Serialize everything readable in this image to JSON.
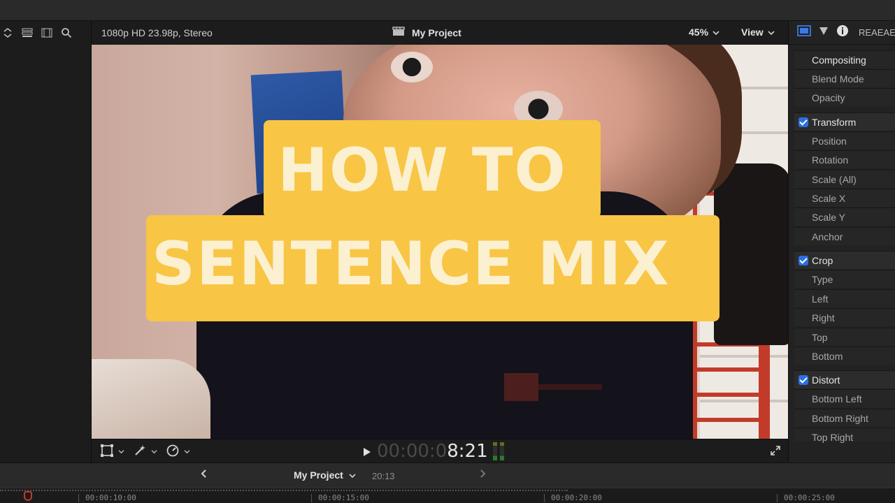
{
  "viewer": {
    "format": "1080p HD 23.98p, Stereo",
    "project_title": "My Project",
    "zoom": "45%",
    "view_label": "View"
  },
  "overlay": {
    "line1": "HOW TO",
    "line2": "SENTENCE MIX"
  },
  "playback": {
    "timecode_dim": "00:00:0",
    "timecode_bright": "8:21"
  },
  "inspector": {
    "tab_label": "REAEAE",
    "rows": [
      {
        "label": "Compositing"
      },
      {
        "label": "Blend Mode"
      },
      {
        "label": "Opacity"
      },
      {
        "label": "Transform"
      },
      {
        "label": "Position"
      },
      {
        "label": "Rotation"
      },
      {
        "label": "Scale (All)"
      },
      {
        "label": "Scale X"
      },
      {
        "label": "Scale Y"
      },
      {
        "label": "Anchor"
      },
      {
        "label": "Crop"
      },
      {
        "label": "Type"
      },
      {
        "label": "Left"
      },
      {
        "label": "Right"
      },
      {
        "label": "Top"
      },
      {
        "label": "Bottom"
      },
      {
        "label": "Distort"
      },
      {
        "label": "Bottom Left"
      },
      {
        "label": "Bottom Right"
      },
      {
        "label": "Top Right"
      }
    ]
  },
  "timeline": {
    "project": "My Project",
    "duration": "20:13",
    "ruler_labels": [
      "00:00:10:00",
      "00:00:15:00",
      "00:00:20:00",
      "00:00:25:00"
    ]
  }
}
